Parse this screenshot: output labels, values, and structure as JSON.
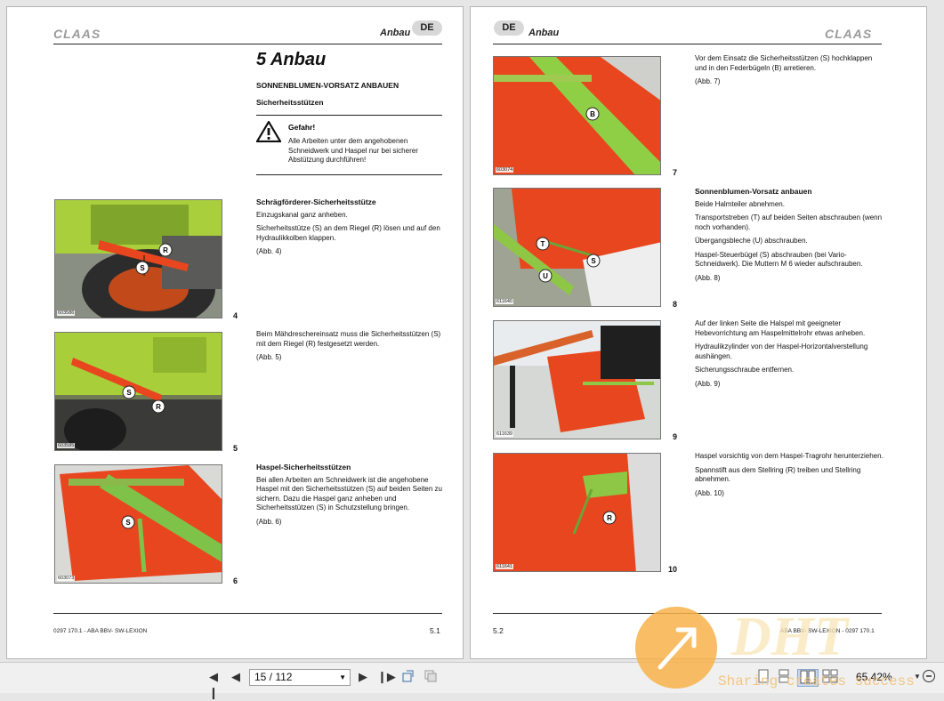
{
  "left_page": {
    "logo": "CLAAS",
    "header_title": "Anbau",
    "lang_badge": "DE",
    "chapter_title": "5 Anbau",
    "section_title": "SONNENBLUMEN-VORSATZ ANBAUEN",
    "subsection_title": "Sicherheitsstützen",
    "warning": {
      "title": "Gefahr!",
      "text": "Alle Arbeiten unter dem angehobenen Schneidwerk und Haspel nur bei sicherer Abstützung durchführen!"
    },
    "blocks": [
      {
        "heading": "Schrägförderer-Sicherheitsstütze",
        "paragraphs": [
          "Einzugskanal ganz anheben.",
          "Sicherheitsstütze (S) an dem Riegel (R) lösen und auf den Hydraulikkolben klappen.",
          "(Abb. 4)"
        ]
      },
      {
        "heading": "",
        "paragraphs": [
          "Beim Mähdreschereinsatz muss die Sicherheitsstützen (S) mit dem Riegel (R) festgesetzt werden.",
          "(Abb. 5)"
        ]
      },
      {
        "heading": "Haspel-Sicherheitsstützen",
        "paragraphs": [
          "Bei allen Arbeiten am Schneidwerk ist die angehobene Haspel mit den Sicherheitsstützen (S) auf beiden Seiten zu sichern. Dazu die Haspel ganz anheben und Sicherheitsstützen (S) in Schutzstellung bringen.",
          "(Abb. 6)"
        ]
      }
    ],
    "figures": [
      {
        "id": "603586",
        "number": "4",
        "labels": [
          "R",
          "S"
        ]
      },
      {
        "id": "603585",
        "number": "5",
        "labels": [
          "S",
          "R"
        ]
      },
      {
        "id": "603073",
        "number": "6",
        "labels": [
          "S"
        ]
      }
    ],
    "footer": "0297 170.1 - ABA BBV- SW-LEXION",
    "page_number": "5.1"
  },
  "right_page": {
    "logo": "CLAAS",
    "header_title": "Anbau",
    "lang_badge": "DE",
    "blocks": [
      {
        "heading": "",
        "paragraphs": [
          "Vor dem Einsatz die Sicherheitsstützen (S) hochklappen und in den Federbügeln (B) arretieren.",
          "(Abb. 7)"
        ]
      },
      {
        "heading": "Sonnenblumen-Vorsatz anbauen",
        "paragraphs": [
          "Beide Halmteiler abnehmen.",
          "Transportstreben (T) auf beiden Seiten abschrauben (wenn noch vorhanden).",
          "Übergangsbleche (U) abschrauben.",
          "Haspel-Steuerbügel (S) abschrauben (bei Vario-Schneidwerk). Die Muttern M 6 wieder aufschrauben.",
          "(Abb. 8)"
        ]
      },
      {
        "heading": "",
        "paragraphs": [
          "Auf der linken Seite die Halspel mit geeigneter Hebevorrichtung am Haspelmittelrohr etwas anheben.",
          "Hydraulikzylinder von der Haspel-Horizontalverstellung aushängen.",
          "Sicherungsschraube entfernen.",
          "(Abb. 9)"
        ]
      },
      {
        "heading": "",
        "paragraphs": [
          "Haspel vorsichtig von dem Haspel-Tragrohr herunterziehen.",
          "Spannstift aus dem Stellring (R) treiben und Stellring abnehmen.",
          "(Abb. 10)"
        ]
      }
    ],
    "figures": [
      {
        "id": "603074",
        "number": "7",
        "labels": [
          "B"
        ]
      },
      {
        "id": "611640",
        "number": "8",
        "labels": [
          "T",
          "S",
          "U"
        ]
      },
      {
        "id": "611639",
        "number": "9",
        "labels": []
      },
      {
        "id": "611641",
        "number": "10",
        "labels": [
          "R"
        ]
      }
    ],
    "footer": "ABA BBV- SW-LEXION - 0297 170.1",
    "page_number": "5.2"
  },
  "toolbar": {
    "page_indicator": "15 / 112",
    "zoom": "65.42%",
    "icons": [
      "first-page-icon",
      "prev-page-icon",
      "next-page-icon",
      "last-page-icon",
      "rotate-icon",
      "copy-icon",
      "single-page-icon",
      "continuous-icon",
      "facing-icon",
      "facing-continuous-icon",
      "zoom-out-icon"
    ]
  },
  "watermark": {
    "text": "Sharing creates success",
    "logo": "DHT"
  }
}
